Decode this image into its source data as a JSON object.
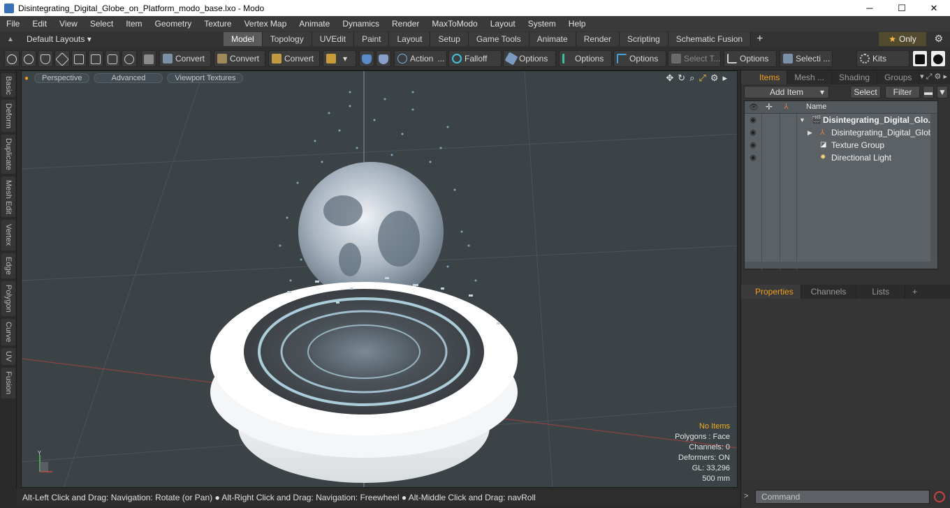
{
  "window": {
    "title": "Disintegrating_Digital_Globe_on_Platform_modo_base.lxo - Modo",
    "minimize": "─",
    "maximize": "☐",
    "close": "✕"
  },
  "menu": [
    "File",
    "Edit",
    "View",
    "Select",
    "Item",
    "Geometry",
    "Texture",
    "Vertex Map",
    "Animate",
    "Dynamics",
    "Render",
    "MaxToModo",
    "Layout",
    "System",
    "Help"
  ],
  "layouts": {
    "dropdown": "Default Layouts ▾",
    "tabs": [
      "Model",
      "Topology",
      "UVEdit",
      "Paint",
      "Layout",
      "Setup",
      "Game Tools",
      "Animate",
      "Render",
      "Scripting",
      "Schematic Fusion"
    ],
    "active": "Model",
    "plus": "+",
    "only_label": "Only",
    "star": "★",
    "gear": "⚙"
  },
  "toolbar": {
    "convert1": "Convert",
    "convert2": "Convert",
    "convert3": "Convert",
    "action": "Action",
    "falloff": "Falloff",
    "options1": "Options",
    "options2": "Options",
    "options3": "Options",
    "select_t": "Select T...",
    "options4": "Options",
    "selecti": "Selecti ...",
    "kits": "Kits",
    "dropdown_arrow": "▾",
    "dots": "..."
  },
  "left_tabs": [
    "Basic",
    "Deform",
    "Duplicate",
    "Mesh Edit",
    "Vertex",
    "Edge",
    "Polygon",
    "Curve",
    "UV",
    "Fusion"
  ],
  "viewport": {
    "perspective": "Perspective",
    "advanced": "Advanced",
    "textures": "Viewport Textures",
    "info": {
      "no_items": "No Items",
      "polygons": "Polygons : Face",
      "channels": "Channels: 0",
      "deformers": "Deformers: ON",
      "gl": "GL: 33,296",
      "scale": "500 mm"
    },
    "axis_y": "Y"
  },
  "status": "Alt-Left Click and Drag: Navigation: Rotate (or Pan) ● Alt-Right Click and Drag: Navigation: Freewheel ● Alt-Middle Click and Drag: navRoll",
  "items_panel": {
    "tabs": [
      "Items",
      "Mesh ...",
      "Shading",
      "Groups"
    ],
    "active": "Items",
    "add_item": "Add Item",
    "select": "Select",
    "filter": "Filter",
    "col_name": "Name",
    "rows": [
      {
        "label": "Disintegrating_Digital_Glo...",
        "level": 0
      },
      {
        "label": "Disintegrating_Digital_Globe ...",
        "level": 1
      },
      {
        "label": "Texture Group",
        "level": 1
      },
      {
        "label": "Directional Light",
        "level": 1
      }
    ]
  },
  "props_panel": {
    "tabs": [
      "Properties",
      "Channels",
      "Lists"
    ],
    "active": "Properties",
    "plus": "+"
  },
  "command": {
    "placeholder": "Command",
    "arrow": ">"
  },
  "colors": {
    "accent": "#f0a020",
    "viewport_bg": "#3b4347",
    "record": "#d04040"
  }
}
